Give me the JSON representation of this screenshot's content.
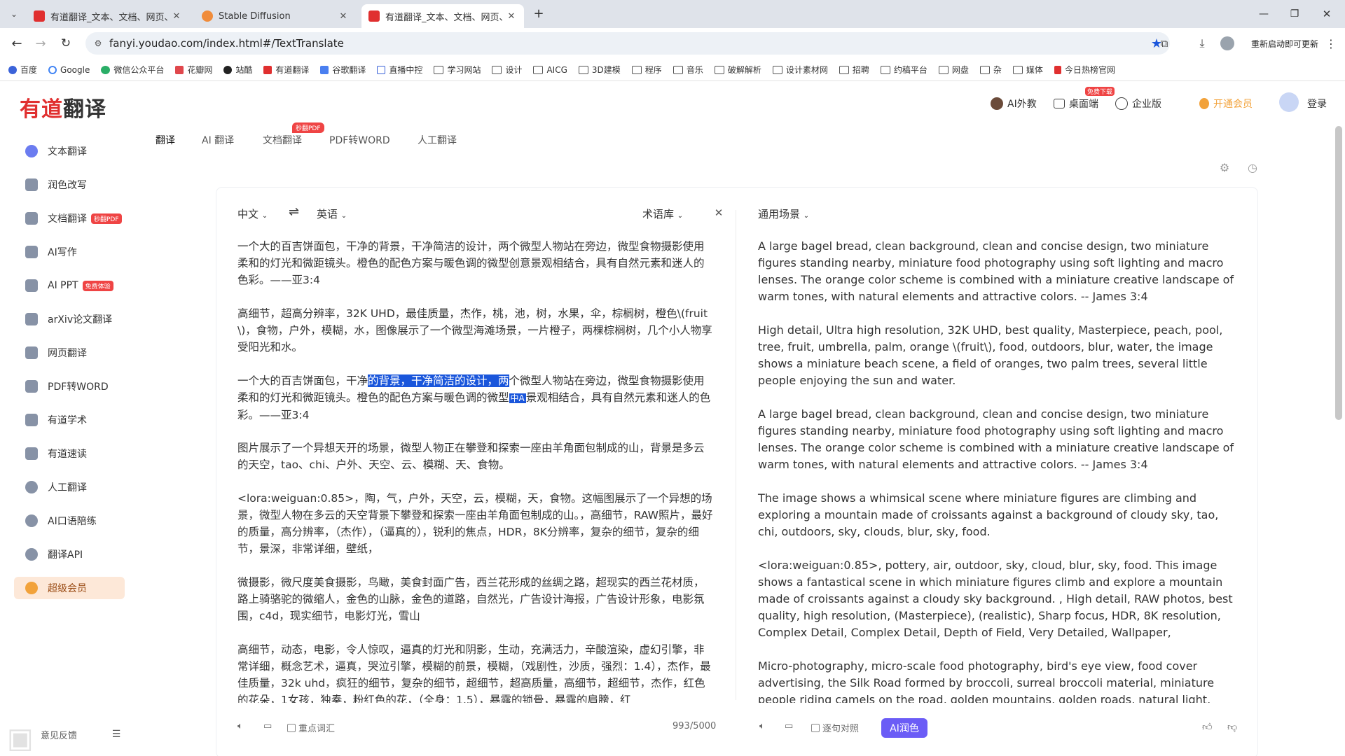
{
  "browser": {
    "tabs": [
      {
        "title": "有道翻译_文本、文档、网页、",
        "active": false,
        "favicon_color": "#e02f2f"
      },
      {
        "title": "Stable Diffusion",
        "active": false,
        "favicon_color": "#f08c3b"
      },
      {
        "title": "有道翻译_文本、文档、网页、",
        "active": true,
        "favicon_color": "#e02f2f"
      }
    ],
    "url": "fanyi.youdao.com/index.html#/TextTranslate",
    "restart_label": "重新启动即可更新",
    "bookmarks": [
      "百度",
      "Google",
      "微信公众平台",
      "花瓣网",
      "站酷",
      "有道翻译",
      "谷歌翻译",
      "直播中控",
      "学习网站",
      "设计",
      "AICG",
      "3D建模",
      "程序",
      "音乐",
      "破解解析",
      "设计素材网",
      "招聘",
      "约稿平台",
      "网盘",
      "杂",
      "媒体",
      "今日热榜官网"
    ]
  },
  "header": {
    "logo_red": "有道",
    "logo_dark": "翻译",
    "items": [
      "AI外教",
      "桌面端",
      "企业版",
      "开通会员",
      "登录"
    ],
    "desktop_tag": "免费下载"
  },
  "sidebar": {
    "items": [
      {
        "label": "文本翻译",
        "badge": ""
      },
      {
        "label": "润色改写",
        "badge": ""
      },
      {
        "label": "文档翻译",
        "badge": "秒翻PDF"
      },
      {
        "label": "AI写作",
        "badge": ""
      },
      {
        "label": "AI PPT",
        "badge": "免费体验"
      },
      {
        "label": "arXiv论文翻译",
        "badge": ""
      },
      {
        "label": "网页翻译",
        "badge": ""
      },
      {
        "label": "PDF转WORD",
        "badge": ""
      },
      {
        "label": "有道学术",
        "badge": ""
      },
      {
        "label": "有道速读",
        "badge": ""
      },
      {
        "label": "人工翻译",
        "badge": ""
      },
      {
        "label": "AI口语陪练",
        "badge": ""
      },
      {
        "label": "翻译API",
        "badge": ""
      }
    ],
    "vip_label": "超级会员",
    "feedback": "意见反馈"
  },
  "subtabs": [
    "翻译",
    "AI 翻译",
    "文档翻译",
    "PDF转WORD",
    "人工翻译"
  ],
  "subtab_pdf_tag": "秒翻PDF",
  "translator": {
    "source_lang": "中文",
    "target_lang": "英语",
    "swap_icon": "⇌",
    "termbase": "术语库",
    "scene": "通用场景",
    "highlight": "的背景，干净简洁的设计，两",
    "source": {
      "p1": "一个大的百吉饼面包，干净的背景，干净简洁的设计，两个微型人物站在旁边，微型食物摄影使用柔和的灯光和微距镜头。橙色的配色方案与暖色调的微型创意景观相结合，具有自然元素和迷人的色彩。——亚3:4",
      "p2": "高细节，超高分辨率，32K UHD，最佳质量，杰作，桃，池，树，水果，伞，棕榈树，橙色\\(fruit\\)，食物，户外，模糊，水，图像展示了一个微型海滩场景，一片橙子，两棵棕榈树，几个小人物享受阳光和水。",
      "p3a": "一个大的百吉饼面包，干净",
      "p3b": "个微型人物站在旁边，微型食物摄影使用柔和的灯光和微距镜头。橙色的配色方案与暖色调的微型",
      "p3c": "景观相结合，具有自然元素和迷人的色彩。——亚3:4",
      "p3_selection_icon": "中A",
      "p4": "图片展示了一个异想天开的场景，微型人物正在攀登和探索一座由羊角面包制成的山，背景是多云的天空，tao、chi、户外、天空、云、模糊、天、食物。",
      "p5": "<lora:weiguan:0.85>，陶，气，户外，天空，云，模糊，天，食物。这幅图展示了一个异想的场景，微型人物在多云的天空背景下攀登和探索一座由羊角面包制成的山。，高细节，RAW照片，最好的质量，高分辨率，（杰作），（逼真的），锐利的焦点，HDR，8K分辨率，复杂的细节，复杂的细节，景深，非常详细，壁纸，",
      "p6": "微摄影，微尺度美食摄影，鸟瞰，美食封面广告，西兰花形成的丝绸之路，超现实的西兰花材质，路上骑骆驼的微缩人，金色的山脉，金色的道路，自然光，广告设计海报，广告设计形象，电影氛围，c4d，现实细节，电影灯光，雪山",
      "p7": "高细节，动态，电影，令人惊叹，逼真的灯光和阴影，生动，充满活力，辛酸渲染，虚幻引擎，非常详细，概念艺术，逼真，哭泣引擎，模糊的前景，模糊，（戏剧性，沙质，强烈：1.4），杰作，最佳质量，32k uhd，疯狂的细节，复杂的细节，超细节，超高质量，高细节，超细节，杰作，红色的花朵，1女孩，独奏，粉红色的花，（全身：1.5），暴露的锁骨，暴露的肩膀，红"
    },
    "target": {
      "p1": "A large bagel bread, clean background, clean and concise design, two miniature figures standing nearby, miniature food photography using soft lighting and macro lenses. The orange color scheme is combined with a miniature creative landscape of warm tones, with natural elements and attractive colors. -- James 3:4",
      "p2": "High detail, Ultra high resolution, 32K UHD, best quality, Masterpiece, peach, pool, tree, fruit, umbrella, palm, orange \\(fruit\\), food, outdoors, blur, water, the image shows a miniature beach scene, a field of oranges, two palm trees, several little people enjoying the sun and water.",
      "p3": "A large bagel bread, clean background, clean and concise design, two miniature figures standing nearby, miniature food photography using soft lighting and macro lenses. The orange color scheme is combined with a miniature creative landscape of warm tones, with natural elements and attractive colors. -- James 3:4",
      "p4": "The image shows a whimsical scene where miniature figures are climbing and exploring a mountain made of croissants against a background of cloudy sky, tao, chi, outdoors, sky, clouds, blur, sky, food.",
      "p5": "<lora:weiguan:0.85>, pottery, air, outdoor, sky, cloud, blur, sky, food. This image shows a fantastical scene in which miniature figures climb and explore a mountain made of croissants against a cloudy sky background. , High detail, RAW photos, best quality, high resolution, (Masterpiece), (realistic), Sharp focus, HDR, 8K resolution, Complex Detail, Complex Detail, Depth of Field, Very Detailed, Wallpaper,",
      "p6": "Micro-photography, micro-scale food photography, bird's eye view, food cover advertising, the Silk Road formed by broccoli, surreal broccoli material, miniature people riding camels on the road, golden mountains, golden roads, natural light, advertising"
    },
    "footer": {
      "keywords": "重点词汇",
      "count": "993/5000",
      "sentence_compare": "逐句对照",
      "ai_polish": "AI润色"
    }
  },
  "colors": {
    "brand": "#e02f2f",
    "highlight": "#1a56db",
    "ai_button": "#6b5cf6"
  }
}
